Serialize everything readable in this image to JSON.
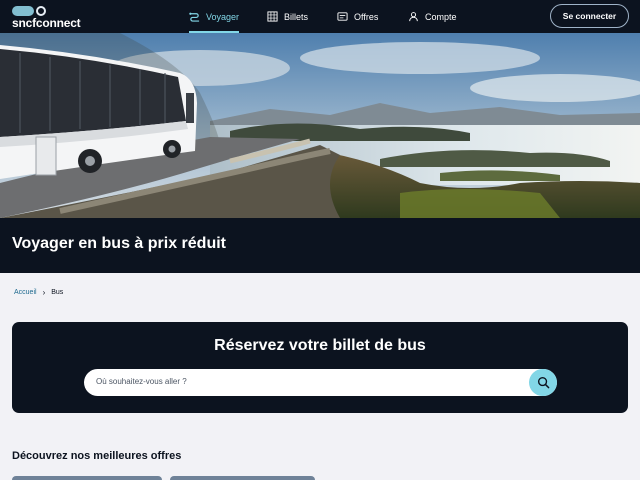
{
  "header": {
    "logo_text": "sncfconnect",
    "nav": [
      {
        "label": "Voyager",
        "icon": "route-icon",
        "active": true
      },
      {
        "label": "Billets",
        "icon": "ticket-grid-icon",
        "active": false
      },
      {
        "label": "Offres",
        "icon": "card-icon",
        "active": false
      },
      {
        "label": "Compte",
        "icon": "user-icon",
        "active": false
      }
    ],
    "login_label": "Se connecter"
  },
  "hero": {
    "image": "photo: white coach bus on a stone-walled coastal road overlooking a lake and hills",
    "title": "Voyager en bus à prix réduit"
  },
  "breadcrumb": {
    "home": "Accueil",
    "current": "Bus"
  },
  "booking": {
    "title": "Réservez votre billet de bus",
    "search": {
      "placeholder": "Où souhaitez-vous aller ?",
      "value": "",
      "icon": "search-icon"
    }
  },
  "offers": {
    "title": "Découvrez nos meilleures offres"
  },
  "colors": {
    "dark": "#0c131f",
    "accent": "#82d6e6",
    "link": "#1f6a8f",
    "page_bg": "#f2f2f6"
  }
}
